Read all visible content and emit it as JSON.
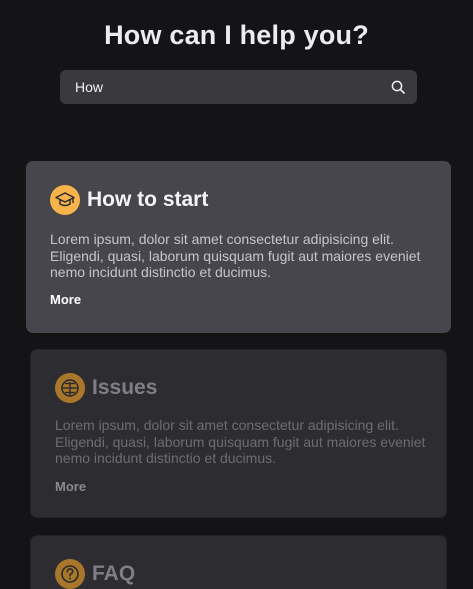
{
  "header": {
    "title": "How can I help you?"
  },
  "search": {
    "value": "How",
    "icon": "search-icon"
  },
  "cards": [
    {
      "title": "How to start",
      "icon": "graduation-cap-icon",
      "text": "Lorem ipsum, dolor sit amet consectetur adipisicing elit. Eligendi, quasi, laborum quisquam fugit aut maiores eveniet nemo incidunt distinctio et ducimus.",
      "more": "More",
      "state": "active"
    },
    {
      "title": "Issues",
      "icon": "bug-icon",
      "text": "Lorem ipsum, dolor sit amet consectetur adipisicing elit. Eligendi, quasi, laborum quisquam fugit aut maiores eveniet nemo incidunt distinctio et ducimus.",
      "more": "More",
      "state": "dimmed"
    },
    {
      "title": "FAQ",
      "icon": "question-circle-icon",
      "state": "dimmed"
    }
  ],
  "colors": {
    "background": "#141416",
    "card_active": "#47464c",
    "card_dimmed": "#2d2d31",
    "accent": "#f7b44a"
  }
}
